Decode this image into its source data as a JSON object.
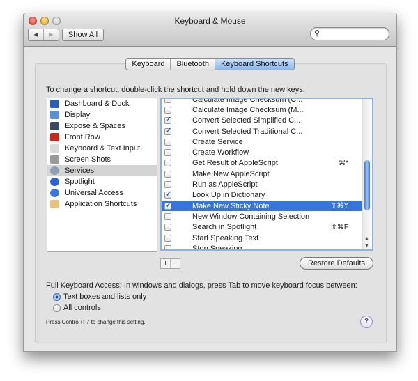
{
  "window": {
    "title": "Keyboard & Mouse"
  },
  "toolbar": {
    "back_icon": "◀",
    "forward_icon": "▶",
    "show_all_label": "Show All",
    "search_icon": "🔍",
    "search_value": ""
  },
  "tabs": [
    {
      "label": "Keyboard",
      "active": false
    },
    {
      "label": "Bluetooth",
      "active": false
    },
    {
      "label": "Keyboard Shortcuts",
      "active": true
    }
  ],
  "instruction": "To change a shortcut, double-click the shortcut and hold down the new keys.",
  "categories": [
    {
      "label": "Dashboard & Dock",
      "icon": "dock-icon",
      "color": "#2d5fb0"
    },
    {
      "label": "Display",
      "icon": "display-icon",
      "color": "#5a8fd6"
    },
    {
      "label": "Exposé & Spaces",
      "icon": "expose-icon",
      "color": "#3a4a66"
    },
    {
      "label": "Front Row",
      "icon": "front-row-icon",
      "color": "#c8281e"
    },
    {
      "label": "Keyboard & Text Input",
      "icon": "keyboard-icon",
      "color": "#d9d9d9"
    },
    {
      "label": "Screen Shots",
      "icon": "screenshot-icon",
      "color": "#9a9a9a"
    },
    {
      "label": "Services",
      "icon": "services-icon",
      "color": "#8d9fb6",
      "selected": true
    },
    {
      "label": "Spotlight",
      "icon": "spotlight-icon",
      "color": "#2b63d4"
    },
    {
      "label": "Universal Access",
      "icon": "universal-access-icon",
      "color": "#3a7ae0"
    },
    {
      "label": "Application Shortcuts",
      "icon": "app-shortcuts-icon",
      "color": "#e8c27a"
    }
  ],
  "services": [
    {
      "label": "Calculate Image Checksum (C...",
      "checked": false,
      "shortcut": ""
    },
    {
      "label": "Calculate Image Checksum (M...",
      "checked": false,
      "shortcut": ""
    },
    {
      "label": "Convert Selected Simplified C...",
      "checked": true,
      "shortcut": ""
    },
    {
      "label": "Convert Selected Traditional C...",
      "checked": true,
      "shortcut": ""
    },
    {
      "label": "Create Service",
      "checked": false,
      "shortcut": ""
    },
    {
      "label": "Create Workflow",
      "checked": false,
      "shortcut": ""
    },
    {
      "label": "Get Result of AppleScript",
      "checked": false,
      "shortcut": "⌘*"
    },
    {
      "label": "Make New AppleScript",
      "checked": false,
      "shortcut": ""
    },
    {
      "label": "Run as AppleScript",
      "checked": false,
      "shortcut": ""
    },
    {
      "label": "Look Up in Dictionary",
      "checked": true,
      "shortcut": ""
    },
    {
      "label": "Make New Sticky Note",
      "checked": true,
      "shortcut": "⇧⌘Y",
      "selected": true
    },
    {
      "label": "New Window Containing Selection",
      "checked": false,
      "shortcut": ""
    },
    {
      "label": "Search in Spotlight",
      "checked": false,
      "shortcut": "⇧⌘F"
    },
    {
      "label": "Start Speaking Text",
      "checked": false,
      "shortcut": ""
    },
    {
      "label": "Stop Speaking",
      "checked": false,
      "shortcut": ""
    }
  ],
  "list_controls": {
    "add_label": "+",
    "remove_label": "−"
  },
  "restore_defaults_label": "Restore Defaults",
  "full_keyboard_access": {
    "label": "Full Keyboard Access: In windows and dialogs, press Tab to move keyboard focus between:",
    "options": [
      {
        "label": "Text boxes and lists only",
        "selected": true
      },
      {
        "label": "All controls",
        "selected": false
      }
    ],
    "note": "Press Control+F7 to change this setting."
  },
  "help_label": "?"
}
